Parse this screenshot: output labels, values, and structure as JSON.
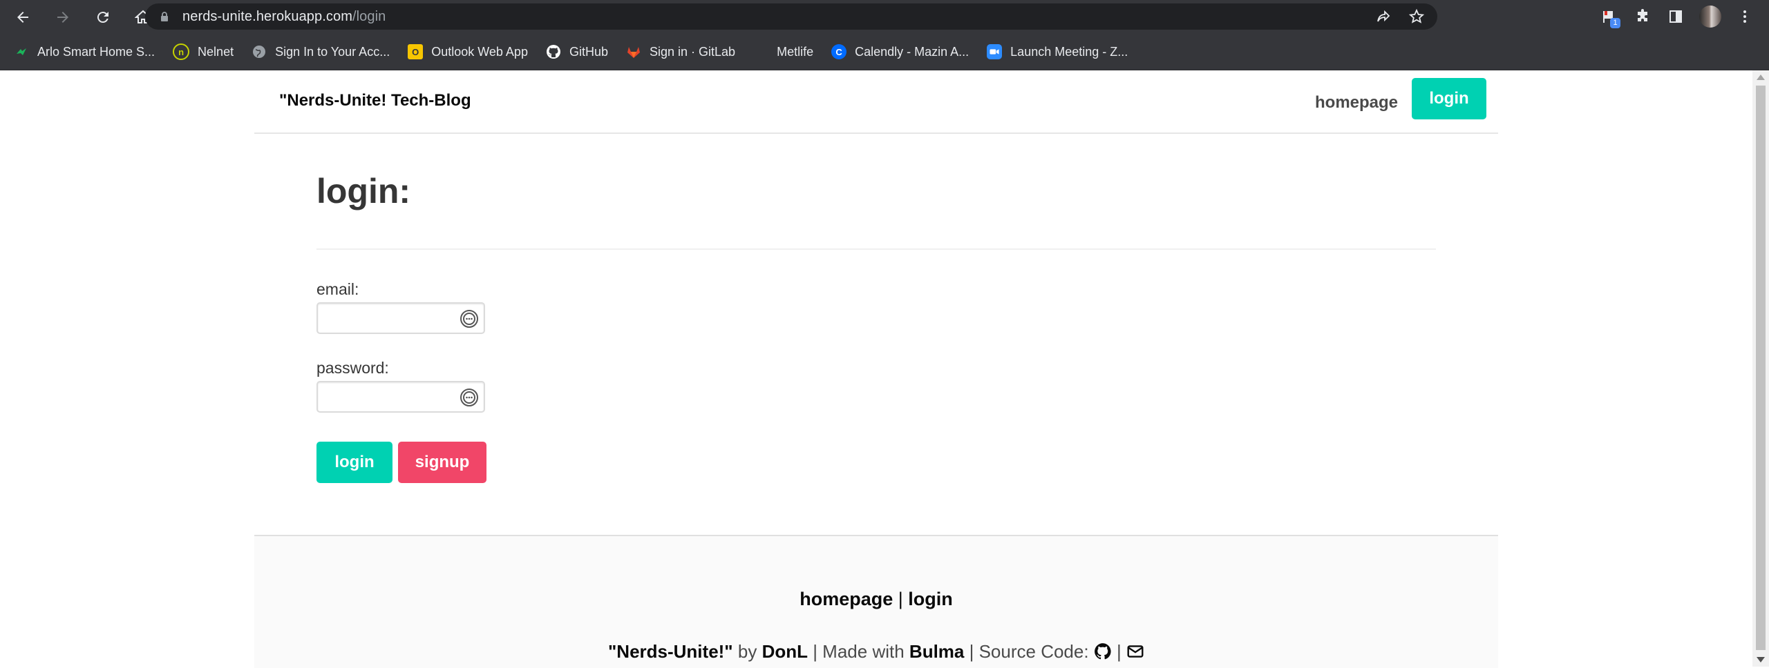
{
  "browser": {
    "url_host": "nerds-unite.herokuapp.com",
    "url_path": "/login",
    "extension_badge": "1",
    "bookmarks": [
      {
        "label": "Arlo Smart Home S...",
        "icon": "arlo-icon",
        "color": "#1bb35a"
      },
      {
        "label": "Nelnet",
        "icon": "nelnet-icon",
        "color": "#c6d300"
      },
      {
        "label": "Sign In to Your Acc...",
        "icon": "globe-icon",
        "color": "#9aa0a6"
      },
      {
        "label": "Outlook Web App",
        "icon": "outlook-icon",
        "color": "#f7c600"
      },
      {
        "label": "GitHub",
        "icon": "github-icon",
        "color": "#ffffff"
      },
      {
        "label": "Sign in · GitLab",
        "icon": "gitlab-icon",
        "color": "#e2432a"
      },
      {
        "label": "Metlife",
        "icon": "metlife-icon",
        "color": "#35363a"
      },
      {
        "label": "Calendly - Mazin A...",
        "icon": "calendly-icon",
        "color": "#006bff"
      },
      {
        "label": "Launch Meeting - Z...",
        "icon": "zoom-icon",
        "color": "#2d8cff"
      }
    ]
  },
  "navbar": {
    "brand": "\"Nerds-Unite! Tech-Blog",
    "home_link": "homepage",
    "login_button": "login"
  },
  "main": {
    "title": "login:",
    "email_label": "email:",
    "email_value": "",
    "password_label": "password:",
    "password_value": "",
    "login_button": "login",
    "signup_button": "signup"
  },
  "footer": {
    "link_home": "homepage",
    "link_sep": " | ",
    "link_login": "login",
    "project": "\"Nerds-Unite!\"",
    "by": " by ",
    "author": "DonL",
    "made_with": " | Made with ",
    "framework": "Bulma",
    "source": " | Source Code: ",
    "sep2": " | "
  },
  "colors": {
    "primary": "#00d1b2",
    "danger": "#f14668",
    "chrome_bg": "#35363a"
  }
}
